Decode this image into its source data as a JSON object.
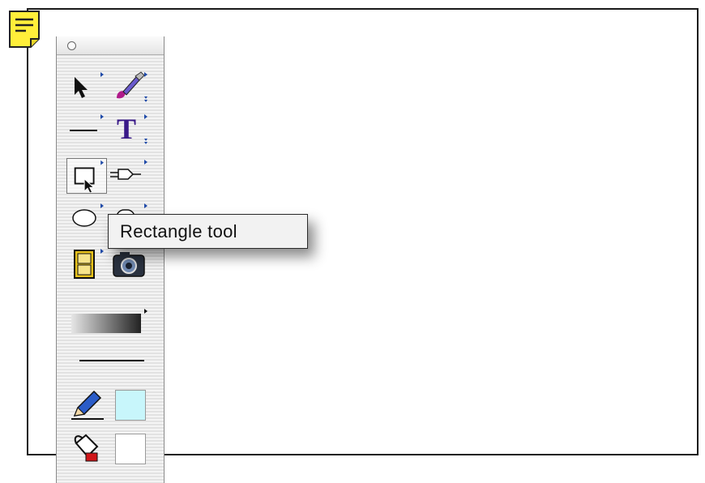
{
  "tooltip": {
    "text": "Rectangle tool"
  },
  "palette": {
    "tools": [
      {
        "name": "selection-arrow-icon"
      },
      {
        "name": "paintbrush-icon"
      },
      {
        "name": "line-icon"
      },
      {
        "name": "text-tool-icon"
      },
      {
        "name": "rectangle-icon"
      },
      {
        "name": "connector-icon"
      },
      {
        "name": "oval-icon"
      },
      {
        "name": "rounded-rect-icon"
      },
      {
        "name": "film-icon"
      },
      {
        "name": "camera-icon"
      },
      {
        "name": "gradient-icon"
      },
      {
        "name": "line-weight-icon"
      },
      {
        "name": "pencil-icon"
      },
      {
        "name": "paint-bucket-icon"
      }
    ],
    "selected_tool": "rectangle",
    "stroke_color": "#c8f6fb",
    "fill_color": "#ffffff"
  },
  "colors": {
    "note_yellow": "#ffef3a",
    "popup_arrow": "#1f4aa8",
    "text_tool_purple": "#3a1a88"
  }
}
